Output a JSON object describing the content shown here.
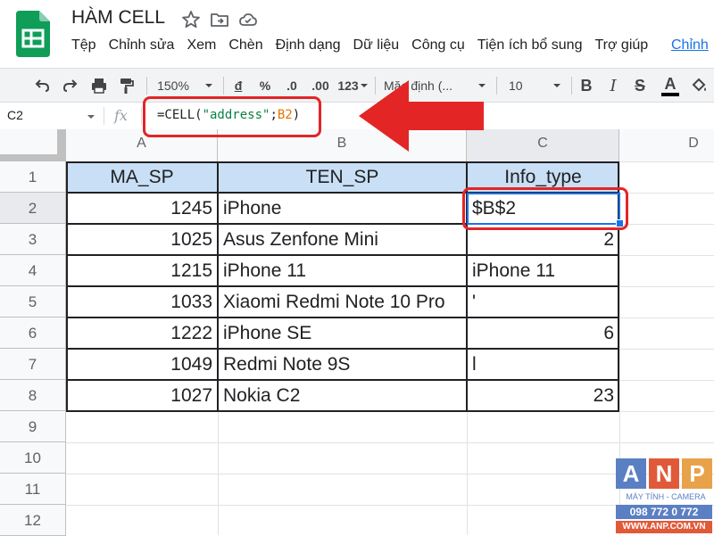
{
  "app": {
    "doc_title": "HÀM CELL",
    "menu": [
      "Tệp",
      "Chỉnh sửa",
      "Xem",
      "Chèn",
      "Định dạng",
      "Dữ liệu",
      "Công cụ",
      "Tiện ích bổ sung",
      "Trợ giúp"
    ],
    "menu_last": "Chỉnh",
    "accent": "#1a73e8",
    "highlight_red": "#e32526"
  },
  "toolbar": {
    "zoom": "150%",
    "currency": "đ",
    "percent": "%",
    "dec_decrease": ".0",
    "dec_increase": ".00",
    "number_format": "123",
    "font": "Mặc định (...",
    "font_size": "10",
    "bold": "B",
    "italic": "I",
    "strike": "S",
    "text_color": "A"
  },
  "formula_bar": {
    "name_box": "C2",
    "fx": "fx",
    "formula_prefix": "=CELL(",
    "formula_str": "\"address\"",
    "formula_sep": ";",
    "formula_ref": "B2",
    "formula_suffix": ")"
  },
  "sheet": {
    "columns": [
      "A",
      "B",
      "C",
      "D"
    ],
    "rows": [
      "1",
      "2",
      "3",
      "4",
      "5",
      "6",
      "7",
      "8",
      "9",
      "10",
      "11",
      "12"
    ],
    "headers": [
      "MA_SP",
      "TEN_SP",
      "Info_type"
    ],
    "data": [
      [
        "1245",
        "iPhone",
        "$B$2"
      ],
      [
        "1025",
        "Asus Zenfone Mini",
        "2"
      ],
      [
        "1215",
        "iPhone 11",
        "iPhone 11"
      ],
      [
        "1033",
        "Xiaomi Redmi Note 10 Pro",
        "'"
      ],
      [
        "1222",
        "iPhone SE",
        "6"
      ],
      [
        "1049",
        "Redmi Note 9S",
        "l"
      ],
      [
        "1027",
        "Nokia C2",
        "23"
      ]
    ],
    "header_fill": "#c8dff5",
    "selected_cell": "C2"
  },
  "watermark": {
    "letters": [
      "A",
      "N",
      "P"
    ],
    "tagline": "MÁY TÍNH - CAMERA",
    "phone": "098 772 0 772",
    "site": "WWW.ANP.COM.VN"
  }
}
